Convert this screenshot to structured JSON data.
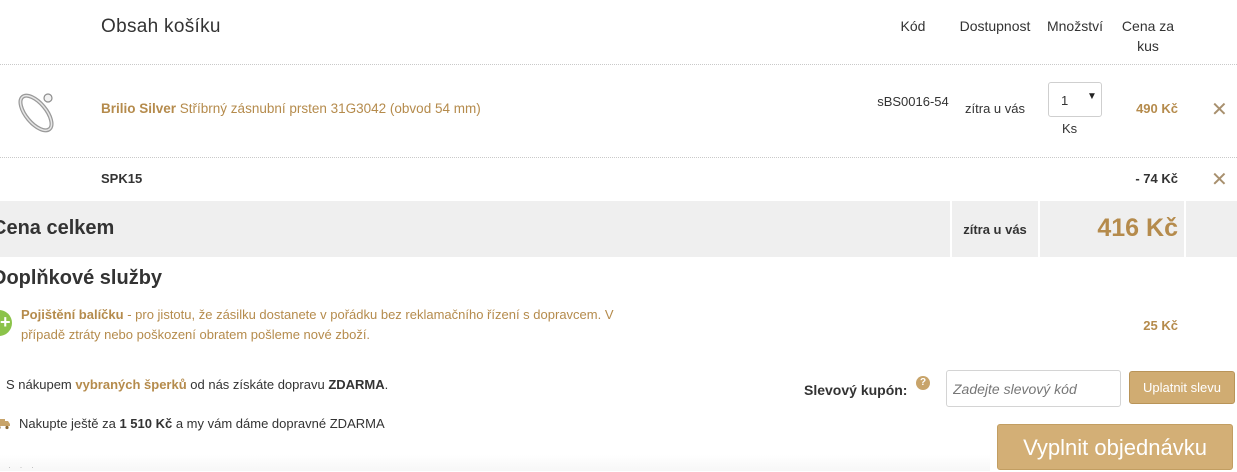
{
  "header": {
    "title": "Obsah košíku",
    "col_code": "Kód",
    "col_availability": "Dostupnost",
    "col_quantity": "Množství",
    "col_unit_price": "Cena za kus"
  },
  "cart_item": {
    "brand": "Brilio Silver",
    "name": "Stříbrný zásnubní prsten 31G3042 (obvod 54 mm)",
    "code": "sBS0016-54",
    "availability": "zítra u vás",
    "quantity": "1",
    "quantity_unit": "Ks",
    "price": "490 Kč",
    "image_icon": "ring-icon",
    "remove_icon": "close-icon"
  },
  "coupon_line": {
    "code": "SPK15",
    "discount": "- 74 Kč",
    "remove_icon": "close-icon"
  },
  "total": {
    "label": "Cena celkem",
    "availability": "zítra u vás",
    "price": "416 Kč"
  },
  "additional": {
    "title": "Doplňkové služby",
    "insurance_title": "Pojištění balíčku",
    "insurance_text": " - pro jistotu, že zásilku dostanete v pořádku bez reklamačního řízení s dopravcem. V případě ztráty nebo poškození obratem pošleme nové zboží.",
    "insurance_price": "25 Kč",
    "insurance_icon": "plus-circle-icon"
  },
  "shipping": {
    "line1_pre": "S nákupem ",
    "line1_link": "vybraných šperků",
    "line1_mid": " od nás získáte dopravu ",
    "line1_bold": "ZDARMA",
    "line1_post": ".",
    "line2_pre": "Nakupte ještě za ",
    "line2_amount": "1 510 Kč",
    "line2_post": " a my vám dáme dopravné ZDARMA",
    "line2_icon": "truck-icon"
  },
  "coupon_form": {
    "label": "Slevový kupón:",
    "help_icon": "question-icon",
    "help_glyph": "?",
    "placeholder": "Zadejte slevový kód",
    "apply_label": "Uplatnit slevu"
  },
  "checkout": {
    "button_label": "Vyplnit objednávku"
  },
  "colors": {
    "accent": "#b58b4c",
    "button": "#d3af76",
    "total_band": "#efefef",
    "insurance_badge": "#8bc34a"
  }
}
